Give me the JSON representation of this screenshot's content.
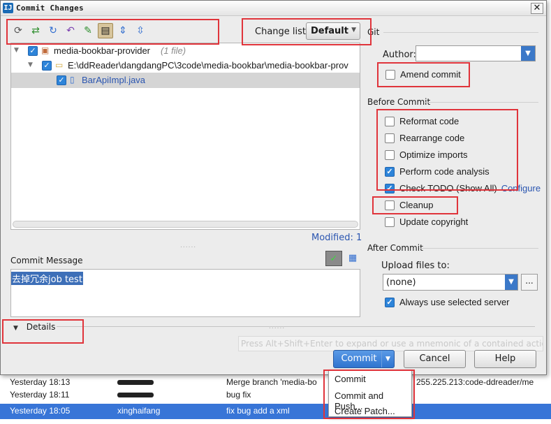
{
  "dialog": {
    "title": "Commit Changes",
    "close_symbol": "✕"
  },
  "toolbar": {
    "icons": [
      "refresh-icon",
      "move-to-changelist-icon",
      "diff-icon",
      "revert-icon",
      "edit-source-icon",
      "group-by-directory-icon",
      "expand-all-icon",
      "collapse-all-icon"
    ],
    "changelist_label": "Change list:",
    "changelist_value": "Default"
  },
  "tree": {
    "root_label": "media-bookbar-provider",
    "root_count": "(1 file)",
    "folder_label": "E:\\ddReader\\dangdangPC\\3code\\media-bookbar\\media-bookbar-prov",
    "file_label": "BarApiImpl.java"
  },
  "modified_text": "Modified: 1",
  "commit_message": {
    "label": "Commit Message",
    "text": "去掉冗余job test"
  },
  "details_label": "Details",
  "git": {
    "section_title": "Git",
    "author_label": "Author:",
    "author_value": "",
    "amend_label": "Amend commit",
    "amend_checked": false
  },
  "before_commit": {
    "title": "Before Commit",
    "options": [
      {
        "label": "Reformat code",
        "checked": false
      },
      {
        "label": "Rearrange code",
        "checked": false
      },
      {
        "label": "Optimize imports",
        "checked": false
      },
      {
        "label": "Perform code analysis",
        "checked": true
      },
      {
        "label": "Check TODO (Show All)",
        "checked": true
      },
      {
        "label": "Cleanup",
        "checked": false
      },
      {
        "label": "Update copyright",
        "checked": false
      }
    ],
    "configure_link": "Configure"
  },
  "after_commit": {
    "title": "After Commit",
    "upload_label": "Upload files to:",
    "upload_value": "(none)",
    "dots_label": "...",
    "always_use_label": "Always use selected server",
    "always_use_checked": true
  },
  "hint_text": "Press Alt+Shift+Enter to expand or use a mnemonic of a contained action",
  "buttons": {
    "commit": "Commit",
    "cancel": "Cancel",
    "help": "Help"
  },
  "commit_menu": [
    "Commit",
    "Commit and Push...",
    "Create Patch..."
  ],
  "log_rows": [
    {
      "date": "Yesterday 18:13",
      "author": "",
      "message": "Merge branch 'media-bo",
      "extra": "255.225.213:code-ddreader/me"
    },
    {
      "date": "Yesterday 18:11",
      "author": "",
      "message": "bug fix",
      "extra": ""
    },
    {
      "date": "Yesterday 18:05",
      "author": "xinghaifang",
      "message": "fix bug add a xml",
      "extra": ""
    }
  ],
  "colors": {
    "annotation": "#e0343b",
    "selection": "#3875d7",
    "checkbox": "#2d84d9",
    "link": "#2a55b0"
  }
}
